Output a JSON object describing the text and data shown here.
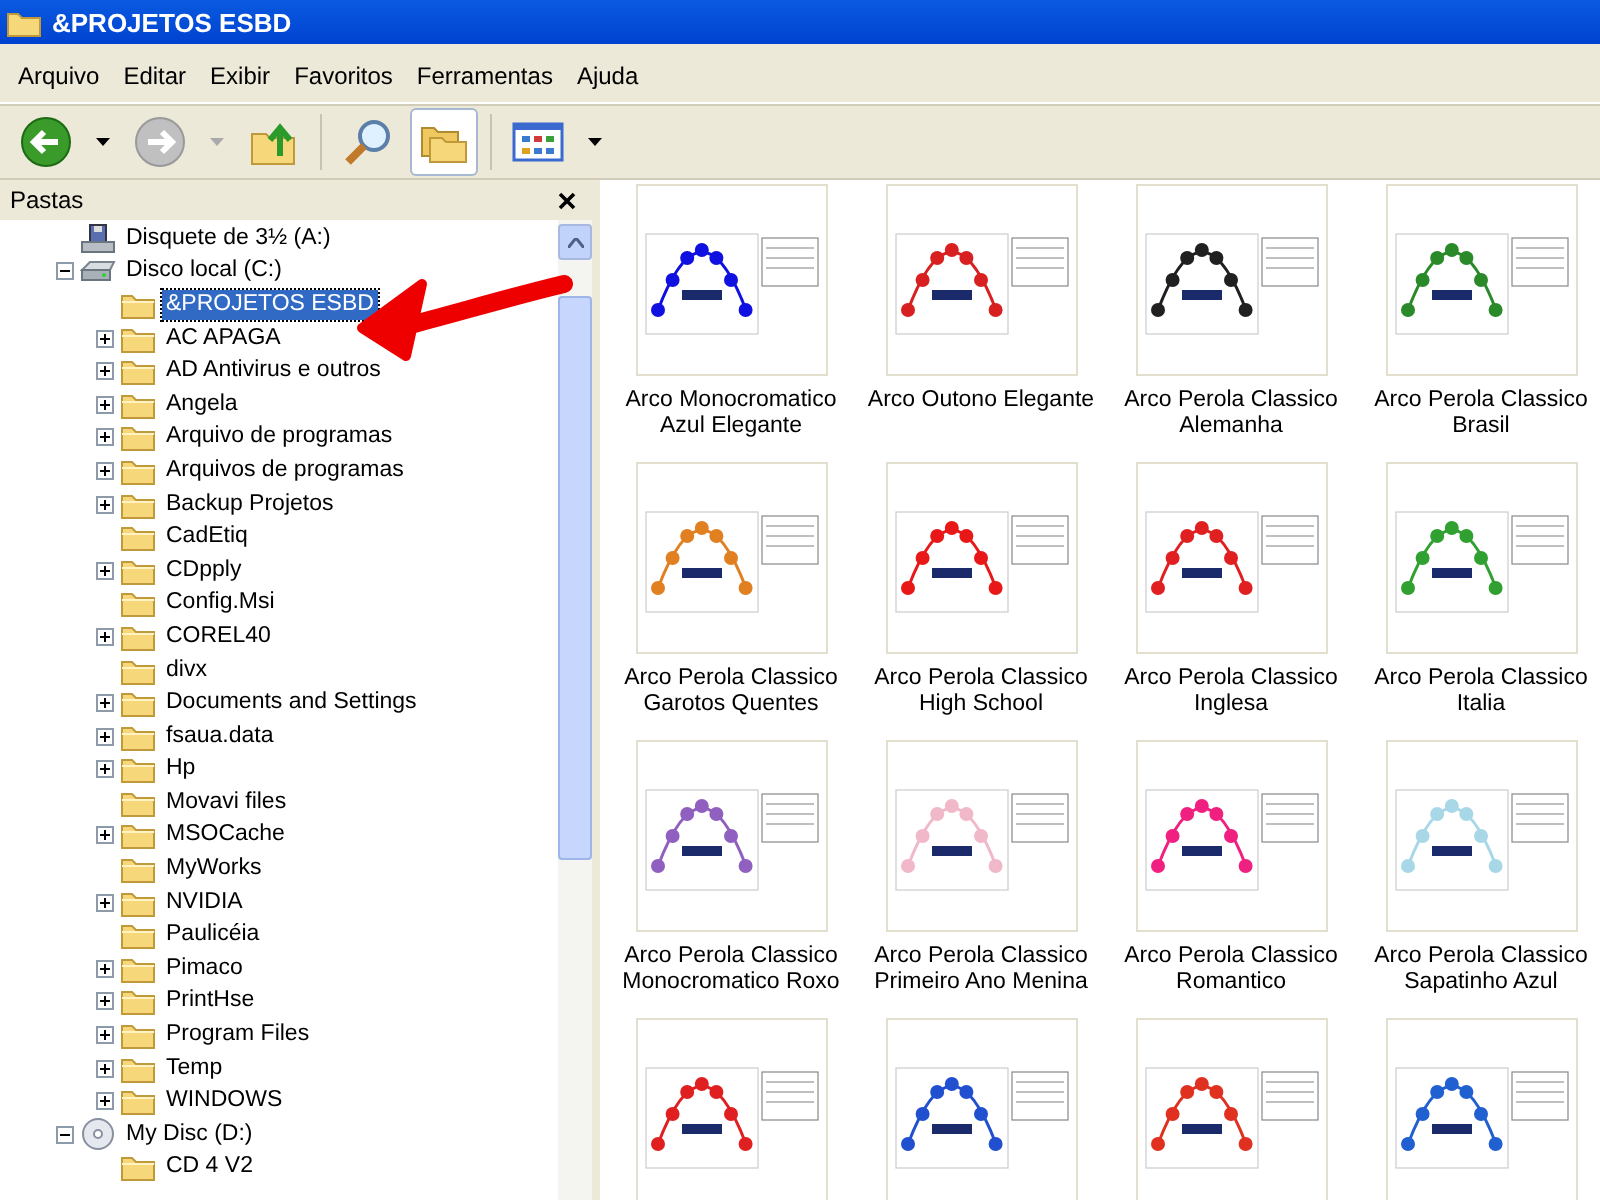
{
  "window": {
    "title": "&PROJETOS ESBD"
  },
  "menu": [
    "Arquivo",
    "Editar",
    "Exibir",
    "Favoritos",
    "Ferramentas",
    "Ajuda"
  ],
  "folders_pane": {
    "title": "Pastas",
    "items": [
      {
        "label": "Disquete de 3½ (A:)",
        "kind": "floppy",
        "expandable": false,
        "selected": false
      },
      {
        "label": "Disco local (C:)",
        "kind": "drive",
        "expandable": true,
        "expanded": true,
        "selected": false,
        "children": [
          {
            "label": "&PROJETOS ESBD",
            "kind": "folder",
            "expandable": false,
            "selected": true
          },
          {
            "label": "AC APAGA",
            "kind": "folder",
            "expandable": true,
            "expanded": false,
            "selected": false
          },
          {
            "label": "AD Antivirus e outros",
            "kind": "folder",
            "expandable": true,
            "expanded": false,
            "selected": false
          },
          {
            "label": "Angela",
            "kind": "folder",
            "expandable": true,
            "expanded": false,
            "selected": false
          },
          {
            "label": "Arquivo de programas",
            "kind": "folder",
            "expandable": true,
            "expanded": false,
            "selected": false
          },
          {
            "label": "Arquivos de programas",
            "kind": "folder",
            "expandable": true,
            "expanded": false,
            "selected": false
          },
          {
            "label": "Backup Projetos",
            "kind": "folder",
            "expandable": true,
            "expanded": false,
            "selected": false
          },
          {
            "label": "CadEtiq",
            "kind": "folder",
            "expandable": false,
            "selected": false
          },
          {
            "label": "CDpply",
            "kind": "folder",
            "expandable": true,
            "expanded": false,
            "selected": false
          },
          {
            "label": "Config.Msi",
            "kind": "folder",
            "expandable": false,
            "selected": false
          },
          {
            "label": "COREL40",
            "kind": "folder",
            "expandable": true,
            "expanded": false,
            "selected": false
          },
          {
            "label": "divx",
            "kind": "folder",
            "expandable": false,
            "selected": false
          },
          {
            "label": "Documents and Settings",
            "kind": "folder",
            "expandable": true,
            "expanded": false,
            "selected": false
          },
          {
            "label": "fsaua.data",
            "kind": "folder",
            "expandable": true,
            "expanded": false,
            "selected": false
          },
          {
            "label": "Hp",
            "kind": "folder",
            "expandable": true,
            "expanded": false,
            "selected": false
          },
          {
            "label": "Movavi files",
            "kind": "folder",
            "expandable": false,
            "selected": false
          },
          {
            "label": "MSOCache",
            "kind": "folder",
            "expandable": true,
            "expanded": false,
            "selected": false
          },
          {
            "label": "MyWorks",
            "kind": "folder",
            "expandable": false,
            "selected": false
          },
          {
            "label": "NVIDIA",
            "kind": "folder",
            "expandable": true,
            "expanded": false,
            "selected": false
          },
          {
            "label": "Paulicéia",
            "kind": "folder",
            "expandable": false,
            "selected": false
          },
          {
            "label": "Pimaco",
            "kind": "folder",
            "expandable": true,
            "expanded": false,
            "selected": false
          },
          {
            "label": "PrintHse",
            "kind": "folder",
            "expandable": true,
            "expanded": false,
            "selected": false
          },
          {
            "label": "Program Files",
            "kind": "folder",
            "expandable": true,
            "expanded": false,
            "selected": false
          },
          {
            "label": "Temp",
            "kind": "folder",
            "expandable": true,
            "expanded": false,
            "selected": false
          },
          {
            "label": "WINDOWS",
            "kind": "folder",
            "expandable": true,
            "expanded": false,
            "selected": false
          }
        ]
      },
      {
        "label": "My Disc (D:)",
        "kind": "cd",
        "expandable": true,
        "expanded": true,
        "selected": false,
        "children": [
          {
            "label": "CD 4 V2",
            "kind": "folder",
            "expandable": false,
            "selected": false
          }
        ]
      }
    ]
  },
  "files": [
    {
      "label": "Arco Monocromatico Azul Elegante",
      "color": "#1010e0"
    },
    {
      "label": "Arco Outono Elegante",
      "color": "#d82020"
    },
    {
      "label": "Arco Perola Classico Alemanha",
      "color": "#202020"
    },
    {
      "label": "Arco Perola Classico Brasil",
      "color": "#2a8a2a"
    },
    {
      "label": "Arco Perola Classico Garotos Quentes",
      "color": "#e08020"
    },
    {
      "label": "Arco Perola Classico High School",
      "color": "#e81818"
    },
    {
      "label": "Arco Perola Classico Inglesa",
      "color": "#e02020"
    },
    {
      "label": "Arco Perola Classico Italia",
      "color": "#30a030"
    },
    {
      "label": "Arco Perola Classico Monocromatico Roxo",
      "color": "#9060c0"
    },
    {
      "label": "Arco Perola Classico Primeiro Ano Menina",
      "color": "#f0b8c8"
    },
    {
      "label": "Arco Perola Classico Romantico",
      "color": "#f02080"
    },
    {
      "label": "Arco Perola Classico Sapatinho Azul",
      "color": "#a8d8e8"
    },
    {
      "color": "#e02020"
    },
    {
      "color": "#2050d0"
    },
    {
      "color": "#e03020"
    },
    {
      "color": "#2060d0"
    }
  ]
}
